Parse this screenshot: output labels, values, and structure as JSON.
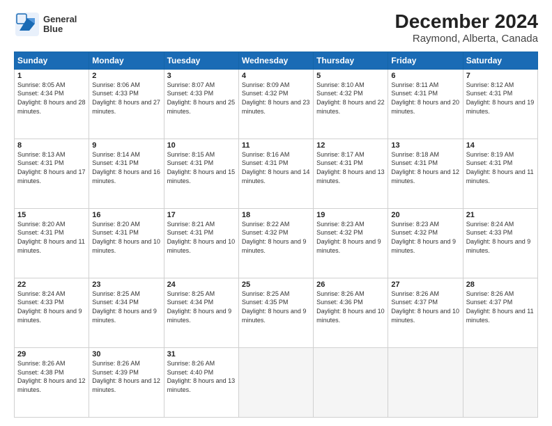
{
  "logo": {
    "line1": "General",
    "line2": "Blue"
  },
  "title": "December 2024",
  "subtitle": "Raymond, Alberta, Canada",
  "days_header": [
    "Sunday",
    "Monday",
    "Tuesday",
    "Wednesday",
    "Thursday",
    "Friday",
    "Saturday"
  ],
  "weeks": [
    [
      {
        "num": "1",
        "sunrise": "8:05 AM",
        "sunset": "4:34 PM",
        "daylight": "8 hours and 28 minutes."
      },
      {
        "num": "2",
        "sunrise": "8:06 AM",
        "sunset": "4:33 PM",
        "daylight": "8 hours and 27 minutes."
      },
      {
        "num": "3",
        "sunrise": "8:07 AM",
        "sunset": "4:33 PM",
        "daylight": "8 hours and 25 minutes."
      },
      {
        "num": "4",
        "sunrise": "8:09 AM",
        "sunset": "4:32 PM",
        "daylight": "8 hours and 23 minutes."
      },
      {
        "num": "5",
        "sunrise": "8:10 AM",
        "sunset": "4:32 PM",
        "daylight": "8 hours and 22 minutes."
      },
      {
        "num": "6",
        "sunrise": "8:11 AM",
        "sunset": "4:31 PM",
        "daylight": "8 hours and 20 minutes."
      },
      {
        "num": "7",
        "sunrise": "8:12 AM",
        "sunset": "4:31 PM",
        "daylight": "8 hours and 19 minutes."
      }
    ],
    [
      {
        "num": "8",
        "sunrise": "8:13 AM",
        "sunset": "4:31 PM",
        "daylight": "8 hours and 17 minutes."
      },
      {
        "num": "9",
        "sunrise": "8:14 AM",
        "sunset": "4:31 PM",
        "daylight": "8 hours and 16 minutes."
      },
      {
        "num": "10",
        "sunrise": "8:15 AM",
        "sunset": "4:31 PM",
        "daylight": "8 hours and 15 minutes."
      },
      {
        "num": "11",
        "sunrise": "8:16 AM",
        "sunset": "4:31 PM",
        "daylight": "8 hours and 14 minutes."
      },
      {
        "num": "12",
        "sunrise": "8:17 AM",
        "sunset": "4:31 PM",
        "daylight": "8 hours and 13 minutes."
      },
      {
        "num": "13",
        "sunrise": "8:18 AM",
        "sunset": "4:31 PM",
        "daylight": "8 hours and 12 minutes."
      },
      {
        "num": "14",
        "sunrise": "8:19 AM",
        "sunset": "4:31 PM",
        "daylight": "8 hours and 11 minutes."
      }
    ],
    [
      {
        "num": "15",
        "sunrise": "8:20 AM",
        "sunset": "4:31 PM",
        "daylight": "8 hours and 11 minutes."
      },
      {
        "num": "16",
        "sunrise": "8:20 AM",
        "sunset": "4:31 PM",
        "daylight": "8 hours and 10 minutes."
      },
      {
        "num": "17",
        "sunrise": "8:21 AM",
        "sunset": "4:31 PM",
        "daylight": "8 hours and 10 minutes."
      },
      {
        "num": "18",
        "sunrise": "8:22 AM",
        "sunset": "4:32 PM",
        "daylight": "8 hours and 9 minutes."
      },
      {
        "num": "19",
        "sunrise": "8:23 AM",
        "sunset": "4:32 PM",
        "daylight": "8 hours and 9 minutes."
      },
      {
        "num": "20",
        "sunrise": "8:23 AM",
        "sunset": "4:32 PM",
        "daylight": "8 hours and 9 minutes."
      },
      {
        "num": "21",
        "sunrise": "8:24 AM",
        "sunset": "4:33 PM",
        "daylight": "8 hours and 9 minutes."
      }
    ],
    [
      {
        "num": "22",
        "sunrise": "8:24 AM",
        "sunset": "4:33 PM",
        "daylight": "8 hours and 9 minutes."
      },
      {
        "num": "23",
        "sunrise": "8:25 AM",
        "sunset": "4:34 PM",
        "daylight": "8 hours and 9 minutes."
      },
      {
        "num": "24",
        "sunrise": "8:25 AM",
        "sunset": "4:34 PM",
        "daylight": "8 hours and 9 minutes."
      },
      {
        "num": "25",
        "sunrise": "8:25 AM",
        "sunset": "4:35 PM",
        "daylight": "8 hours and 9 minutes."
      },
      {
        "num": "26",
        "sunrise": "8:26 AM",
        "sunset": "4:36 PM",
        "daylight": "8 hours and 10 minutes."
      },
      {
        "num": "27",
        "sunrise": "8:26 AM",
        "sunset": "4:37 PM",
        "daylight": "8 hours and 10 minutes."
      },
      {
        "num": "28",
        "sunrise": "8:26 AM",
        "sunset": "4:37 PM",
        "daylight": "8 hours and 11 minutes."
      }
    ],
    [
      {
        "num": "29",
        "sunrise": "8:26 AM",
        "sunset": "4:38 PM",
        "daylight": "8 hours and 12 minutes."
      },
      {
        "num": "30",
        "sunrise": "8:26 AM",
        "sunset": "4:39 PM",
        "daylight": "8 hours and 12 minutes."
      },
      {
        "num": "31",
        "sunrise": "8:26 AM",
        "sunset": "4:40 PM",
        "daylight": "8 hours and 13 minutes."
      },
      null,
      null,
      null,
      null
    ]
  ]
}
